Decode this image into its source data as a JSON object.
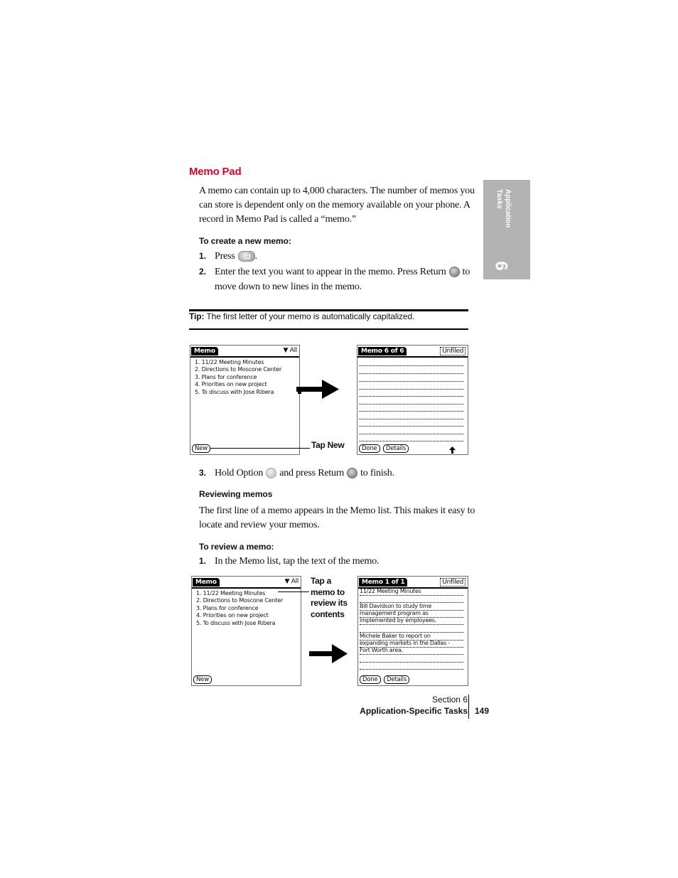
{
  "section_title": "Memo Pad",
  "intro_paragraph": [
    "A memo can contain up to 4,000 characters. The number of memos you",
    "can store is dependent only on the memory available on your phone. A",
    "record in Memo Pad is called a “memo.”"
  ],
  "create_memo": {
    "heading": "To create a new memo:",
    "steps": [
      {
        "num": "1.",
        "text_before": "Press",
        "icon": "memo-pad-button-icon",
        "text_after": "."
      },
      {
        "num": "2.",
        "line1_before": "Enter the text you want to appear in the memo. Press Return",
        "icon": "return-key-icon",
        "line1_after": "to",
        "line2": "move down to new lines in the memo."
      }
    ]
  },
  "tip": {
    "label": "Tip:",
    "text": "The first letter of your memo is automatically capitalized."
  },
  "side_tab": {
    "line1": "Application",
    "line2": "Tasks",
    "number": "6"
  },
  "screen1": {
    "title": "Memo",
    "category": "▼ All",
    "items": [
      "1. 11/22 Meeting Minutes",
      "2. Directions to Moscone Center",
      "3. Plans for conference",
      "4. Priorities on new project",
      "5. To discuss with Jose Ribera"
    ],
    "new_button": "New",
    "callout": "Tap New"
  },
  "screen2": {
    "title": "Memo 6 of 6",
    "category": "Unfiled",
    "done_button": "Done",
    "details_button": "Details",
    "scroll_icon": "up-arrow-icon"
  },
  "step3": {
    "num": "3.",
    "text1": "Hold Option",
    "text2": "and press Return",
    "text3": "to finish."
  },
  "reviewing": {
    "heading": "Reviewing memos",
    "paragraph": [
      "The first line of a memo appears in the Memo list. This makes it easy to",
      "locate and review your memos."
    ]
  },
  "review_memo": {
    "heading": "To review a memo:",
    "steps": [
      {
        "num": "1.",
        "text": "In the Memo list, tap the text of the memo."
      }
    ]
  },
  "screen3": {
    "title": "Memo",
    "category": "▼ All",
    "items": [
      "1. 11/22 Meeting Minutes",
      "2. Directions to Moscone Center",
      "3. Plans for conference",
      "4. Priorities on new project",
      "5. To discuss with Jose Ribera"
    ],
    "new_button": "New",
    "callout": [
      "Tap a",
      "memo to",
      "review its",
      "contents"
    ]
  },
  "screen4": {
    "title": "Memo 1 of 1",
    "category": "Unfiled",
    "lines": [
      "11/22 Meeting Minutes",
      "",
      "Bill Davidson to study time",
      "management program as",
      "implemented by employees.",
      "",
      "Michele Baker to report on",
      "expanding markets in the Dallas -",
      "Fort Worth area.",
      "",
      ""
    ],
    "done_button": "Done",
    "details_button": "Details"
  },
  "footer": {
    "section": "Section 6",
    "title": "Application-Specific Tasks",
    "page": "149"
  }
}
